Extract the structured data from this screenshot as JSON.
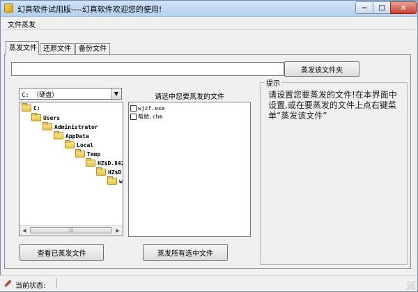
{
  "window": {
    "title": "幻真软件试用版----幻真软件欢迎您的使用!",
    "min_glyph": "─",
    "max_glyph": "☐",
    "close_glyph": "✕"
  },
  "menu": {
    "items": [
      {
        "label": "文件蒸发"
      }
    ]
  },
  "tabs": [
    {
      "label": "蒸发文件",
      "active": true
    },
    {
      "label": "还原文件",
      "active": false
    },
    {
      "label": "备份文件",
      "active": false
    }
  ],
  "evaporate": {
    "path_value": "",
    "evaporate_button": "蒸发该文件夹",
    "drive_select": "C: （硬盘）",
    "drive_arrow": "▼",
    "tree": [
      {
        "label": "C:",
        "level": 0
      },
      {
        "label": "Users",
        "level": 1
      },
      {
        "label": "Administrator",
        "level": 2
      },
      {
        "label": "AppData",
        "level": 3
      },
      {
        "label": "Local",
        "level": 4
      },
      {
        "label": "Temp",
        "level": 5
      },
      {
        "label": "HZ$D.842",
        "level": 6
      },
      {
        "label": "HZ$D.",
        "level": 7
      },
      {
        "label": "wj",
        "level": 8
      }
    ],
    "scroll_left": "◀",
    "scroll_right": "▶",
    "scroll_thumb": "|||",
    "list_header": "请选中您要蒸发的文件",
    "files": [
      {
        "label": "wjzf.exe",
        "checked": false
      },
      {
        "label": "帮助.chm",
        "checked": false
      }
    ],
    "view_button": "查看已蒸发文件",
    "evaporate_selected_button": "蒸发所有选中文件"
  },
  "hint": {
    "title": "提示",
    "text": "请设置您要蒸发的文件!在本界面中设置,或在要蒸发的文件上点右键菜单“蒸发该文件”"
  },
  "status": {
    "label": "当前状态:",
    "value": ""
  },
  "colors": {
    "titlebar": "#c2d9f2",
    "close_button": "#c8432f",
    "folder": "#e9c44a"
  }
}
